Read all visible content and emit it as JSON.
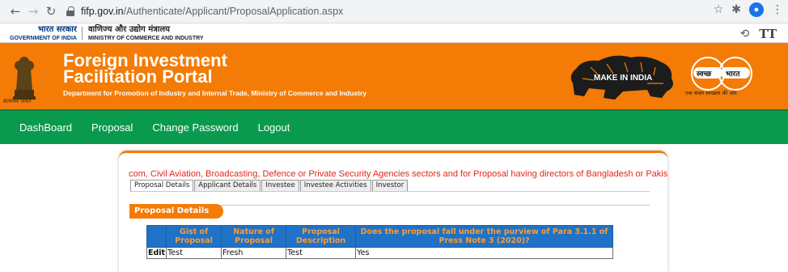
{
  "browser": {
    "url_host": "fifp.gov.in",
    "url_path": "/Authenticate/Applicant/ProposalApplication.aspx",
    "back_glyph": "←",
    "forward_glyph": "→",
    "reload_glyph": "↻",
    "star_glyph": "☆",
    "ext_glyph": "✱",
    "menu_glyph": "⋮",
    "profile_glyph": "●"
  },
  "gov_bar": {
    "gov_hindi": "भारत सरकार",
    "gov_english": "GOVERNMENT OF INDIA",
    "ministry_hindi": "वाणिज्य और उद्योग मंत्रालय",
    "ministry_english": "MINISTRY OF COMMERCE AND INDUSTRY",
    "tool_a": "⟲",
    "tool_t": "TT"
  },
  "banner": {
    "title_line1": "Foreign Investment",
    "title_line2": "Facilitation Portal",
    "subtitle": "Department for Promotion of Industry and Internal Trade, Ministry of Commerce and Industry",
    "emblem_caption": "सत्यमेव जयते",
    "make_in_india": "MAKE IN INDIA",
    "swachh_left": "स्वच्छ",
    "swachh_right": "भारत",
    "swachh_caption": "एक कदम स्वच्छता की ओर",
    "accent_color": "#f47b06"
  },
  "nav": {
    "items": [
      "DashBoard",
      "Proposal",
      "Change Password",
      "Logout"
    ],
    "color": "#0a9a4e"
  },
  "content": {
    "marquee": "com, Civil Aviation, Broadcasting, Defence or Private Security Agencies sectors and for Proposal having directors of Bangladesh or Pakis",
    "tabs": [
      "Proposal Details",
      "Applicant Details",
      "Investee",
      "Investee Activities",
      "Investor"
    ],
    "active_tab": "Proposal Details",
    "section_title": "Proposal Details",
    "table": {
      "headers": [
        "",
        "Gist of Proposal",
        "Nature of Proposal",
        "Proposal Description",
        "Does the proposal fall under the purview of Para 3.1.1 of Press Note 3 (2020)?"
      ],
      "rows": [
        {
          "action": "Edit",
          "gist": "Test",
          "nature": "Fresh",
          "description": "Test",
          "press_note": "Yes"
        }
      ]
    }
  }
}
